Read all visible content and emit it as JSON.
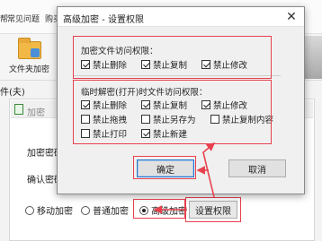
{
  "background": {
    "menu": {
      "left_fragment": "帮",
      "items": [
        "常见问题",
        "购买"
      ]
    },
    "toolbar": {
      "folder_button_label": "文件夹加密"
    },
    "left_label": "件(夫)",
    "panel": {
      "title": "加密",
      "fields": [
        "加密密码",
        "确认密码"
      ]
    },
    "encryption_modes": [
      {
        "label": "移动加密",
        "checked": false
      },
      {
        "label": "普通加密",
        "checked": false
      },
      {
        "label": "高级加密",
        "checked": true
      }
    ],
    "set_permission_button": "设置权限"
  },
  "dialog": {
    "title": "高级加密 - 设置权限",
    "close_glyph": "✕",
    "encrypted_group": {
      "title": "加密文件访问权限：",
      "options": [
        {
          "label": "禁止删除",
          "checked": true
        },
        {
          "label": "禁止复制",
          "checked": true
        },
        {
          "label": "禁止修改",
          "checked": true
        }
      ]
    },
    "temp_group": {
      "title": "临时解密(打开)时文件访问权限：",
      "options": [
        {
          "label": "禁止删除",
          "checked": true
        },
        {
          "label": "禁止复制",
          "checked": true
        },
        {
          "label": "禁止修改",
          "checked": true
        },
        {
          "label": "禁止拖拽",
          "checked": false
        },
        {
          "label": "禁止另存为",
          "checked": false
        },
        {
          "label": "禁止复制内容",
          "checked": false
        },
        {
          "label": "禁止打印",
          "checked": false
        },
        {
          "label": "禁止新建",
          "checked": true
        }
      ]
    },
    "ok_button": "确定",
    "cancel_button": "取消"
  },
  "colors": {
    "annotation_red": "#e8414e",
    "focus_blue": "#2b73c8"
  }
}
